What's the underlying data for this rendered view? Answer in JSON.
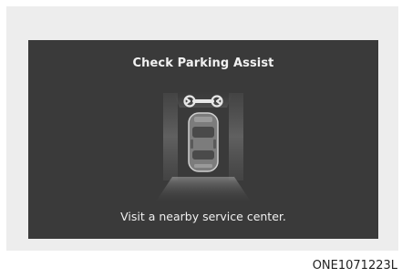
{
  "screen": {
    "title": "Check Parking Assist",
    "message": "Visit a nearby service center."
  },
  "graphic": {
    "warning_icon": "wrench-icon",
    "vehicle": "car-top-view-icon"
  },
  "figure": {
    "code": "ONE1071223L"
  },
  "colors": {
    "frame": "#ededed",
    "screen_bg": "#3a3a3a",
    "text": "#f2f2f2"
  }
}
